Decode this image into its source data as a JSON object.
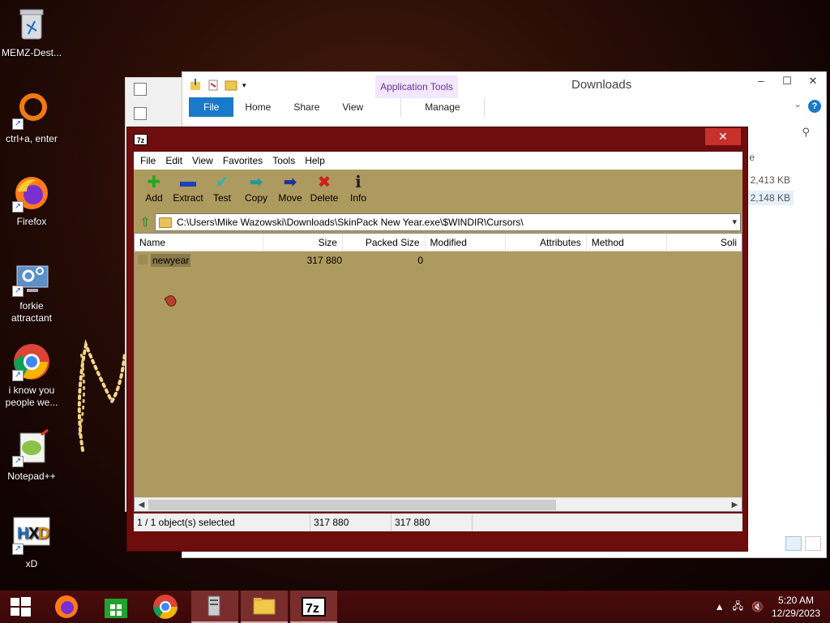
{
  "desktop": {
    "icons": [
      {
        "label": "MEMZ-Dest...",
        "icon": "recycle-bin-icon"
      },
      {
        "label": "ctrl+a, enter",
        "icon": "orange-ring-icon"
      },
      {
        "label": "Firefox",
        "icon": "firefox-icon"
      },
      {
        "label": "forkie attractant",
        "icon": "monitor-gear-icon"
      },
      {
        "label": "i know you people we...",
        "icon": "chrome-icon"
      },
      {
        "label": "Notepad++",
        "icon": "notepadpp-icon"
      },
      {
        "label": "xD",
        "icon": "hxd-icon"
      }
    ]
  },
  "explorer": {
    "title": "Downloads",
    "app_tools_label": "Application Tools",
    "tabs": [
      "File",
      "Home",
      "Share",
      "View"
    ],
    "manage_tab": "Manage",
    "column_partial": "e",
    "sizes": [
      "2,413 KB",
      "2,148 KB"
    ]
  },
  "sevenzip": {
    "logo": "7z",
    "menu": [
      "File",
      "Edit",
      "View",
      "Favorites",
      "Tools",
      "Help"
    ],
    "toolbar": [
      {
        "label": "Add",
        "icon": "add-plus-icon",
        "color": "#1faa1f",
        "glyph": "✚"
      },
      {
        "label": "Extract",
        "icon": "extract-minus-icon",
        "color": "#1f3fbf",
        "glyph": "▬"
      },
      {
        "label": "Test",
        "icon": "test-check-icon",
        "color": "#2bb3b3",
        "glyph": "✔"
      },
      {
        "label": "Copy",
        "icon": "copy-arrow-icon",
        "color": "#1f9a9a",
        "glyph": "➡"
      },
      {
        "label": "Move",
        "icon": "move-arrow-icon",
        "color": "#1f2f9f",
        "glyph": "➡"
      },
      {
        "label": "Delete",
        "icon": "delete-x-icon",
        "color": "#d01f1f",
        "glyph": "✖"
      },
      {
        "label": "Info",
        "icon": "info-icon",
        "color": "#222222",
        "glyph": "ℹ"
      }
    ],
    "path": "C:\\Users\\Mike Wazowski\\Downloads\\SkinPack New Year.exe\\$WINDIR\\Cursors\\",
    "columns": [
      "Name",
      "Size",
      "Packed Size",
      "Modified",
      "Attributes",
      "Method",
      "Soli"
    ],
    "rows": [
      {
        "name": "newyear",
        "size": "317 880",
        "packed": "0"
      }
    ],
    "status": {
      "selected": "1 / 1 object(s) selected",
      "size": "317 880",
      "packed": "317 880"
    }
  },
  "taskbar": {
    "items": [
      "start-icon",
      "firefox-icon",
      "store-icon",
      "chrome-icon",
      "server-icon",
      "file-explorer-icon",
      "sevenzip-icon"
    ],
    "time": "5:20 AM",
    "date": "12/29/2023"
  }
}
